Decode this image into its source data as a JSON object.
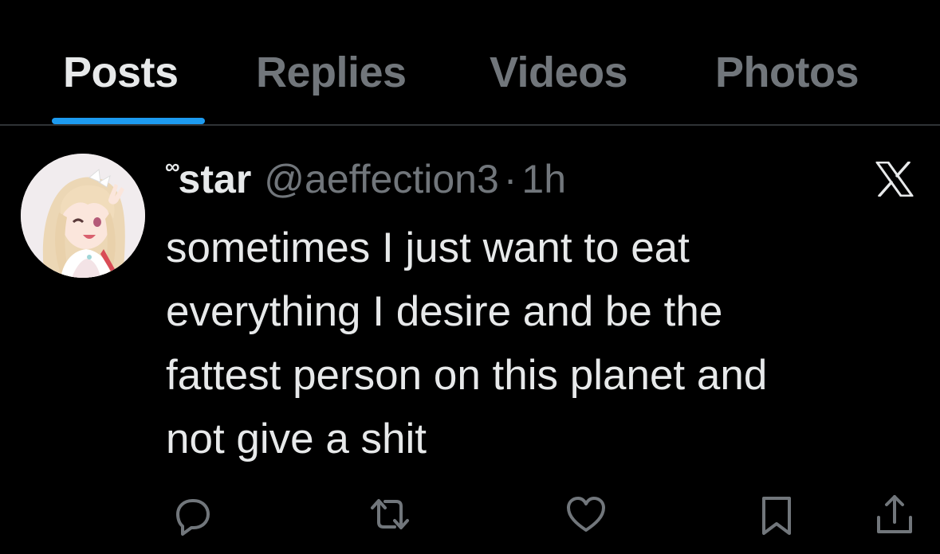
{
  "tabs": [
    {
      "label": "Posts",
      "active": true
    },
    {
      "label": "Replies",
      "active": false
    },
    {
      "label": "Videos",
      "active": false
    },
    {
      "label": "Photos",
      "active": false
    }
  ],
  "colors": {
    "accent": "#1d9bf0",
    "text_primary": "#e7e9ea",
    "text_secondary": "#71767b",
    "background": "#000000",
    "divider": "#2f3336"
  },
  "post": {
    "name_prefix": "∞",
    "display_name": "star",
    "handle": "@aeffection3",
    "separator": "·",
    "time": "1h",
    "text": "sometimes I just want to eat\neverything I desire and be the\nfattest person on this planet and\nnot give a shit",
    "avatar_icon": "anime-avatar",
    "source_icon": "x-logo-icon"
  },
  "actions": [
    {
      "name": "reply-button",
      "icon": "comment-icon"
    },
    {
      "name": "repost-button",
      "icon": "repost-icon"
    },
    {
      "name": "like-button",
      "icon": "heart-icon"
    },
    {
      "name": "bookmark-button",
      "icon": "bookmark-icon"
    },
    {
      "name": "share-button",
      "icon": "share-icon"
    }
  ]
}
